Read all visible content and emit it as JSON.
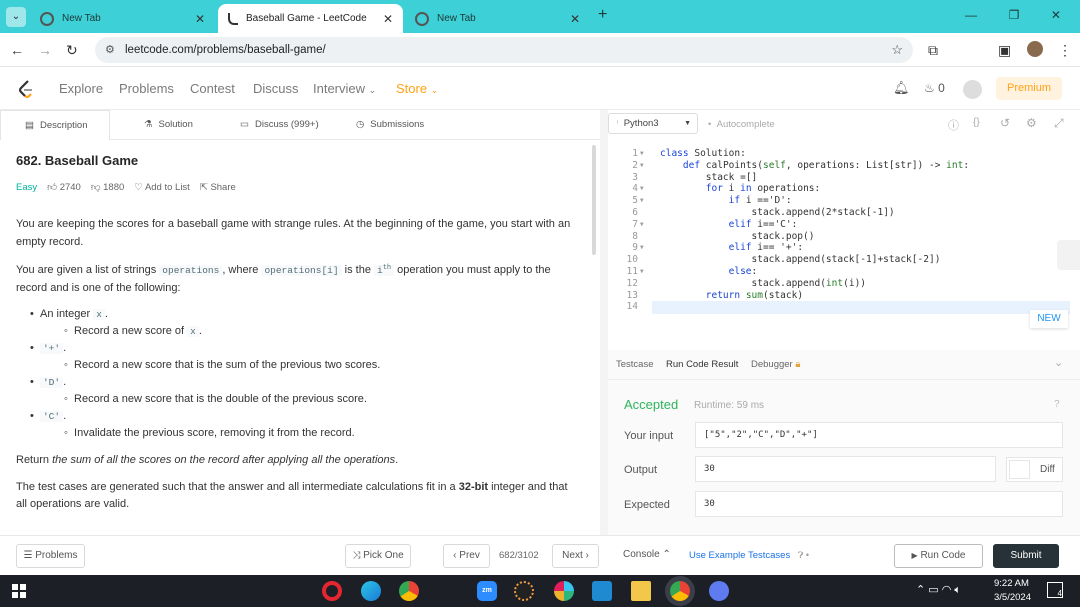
{
  "browser": {
    "tabs": [
      {
        "title": "New Tab",
        "active": false
      },
      {
        "title": "Baseball Game - LeetCode",
        "active": true
      },
      {
        "title": "New Tab",
        "active": false
      }
    ],
    "url": "leetcode.com/problems/baseball-game/"
  },
  "lc_nav": {
    "items": [
      "Explore",
      "Problems",
      "Contest",
      "Discuss",
      "Interview",
      "Store"
    ],
    "notif_count": "0",
    "premium": "Premium"
  },
  "left_tabs": [
    "Description",
    "Solution",
    "Discuss (999+)",
    "Submissions"
  ],
  "problem": {
    "title": "682. Baseball Game",
    "difficulty": "Easy",
    "likes": "2740",
    "dislikes": "1880",
    "add_to_list": "Add to List",
    "share": "Share",
    "p1": "You are keeping the scores for a baseball game with strange rules. At the beginning of the game, you start with an empty record.",
    "p2_a": "You are given a list of strings",
    "p2_code1": "operations",
    "p2_b": ", where",
    "p2_code2": "operations[i]",
    "p2_c": "is the",
    "p2_i": "i",
    "p2_sup": "th",
    "p2_d": "operation you must apply to the record and is one of the following:",
    "rules": [
      {
        "head_pre": "An integer",
        "head_code": "x",
        "head_post": ".",
        "sub": "Record a new score of",
        "sub_code": "x",
        "sub_post": "."
      },
      {
        "head_pre": "",
        "head_code": "'+'",
        "head_post": ".",
        "sub": "Record a new score that is the sum of the previous two scores.",
        "sub_code": "",
        "sub_post": ""
      },
      {
        "head_pre": "",
        "head_code": "'D'",
        "head_post": ".",
        "sub": "Record a new score that is the double of the previous score.",
        "sub_code": "",
        "sub_post": ""
      },
      {
        "head_pre": "",
        "head_code": "'C'",
        "head_post": ".",
        "sub": "Invalidate the previous score, removing it from the record.",
        "sub_code": "",
        "sub_post": ""
      }
    ],
    "p3_a": "Return",
    "p3_b": "the sum of all the scores on the record after applying all the operations",
    "p3_c": ".",
    "p4_a": "The test cases are generated such that the answer and all intermediate calculations fit in a",
    "p4_b": "32-bit",
    "p4_c": "integer and that all operations are valid."
  },
  "editor": {
    "language": "Python3",
    "autocomplete": "Autocomplete",
    "new_badge": "NEW",
    "lines": [
      "class Solution:",
      "    def calPoints(self, operations: List[str]) -> int:",
      "        stack =[]",
      "        for i in operations:",
      "            if i =='D':",
      "                stack.append(2*stack[-1])",
      "            elif i=='C':",
      "                stack.pop()",
      "            elif i== '+':",
      "                stack.append(stack[-1]+stack[-2])",
      "            else:",
      "                stack.append(int(i))",
      "        return sum(stack)",
      ""
    ],
    "folds": [
      1,
      2,
      4,
      5,
      7,
      9,
      11
    ]
  },
  "result": {
    "tabs": [
      "Testcase",
      "Run Code Result",
      "Debugger"
    ],
    "status": "Accepted",
    "runtime": "Runtime: 59 ms",
    "your_input_label": "Your input",
    "your_input": "[\"5\",\"2\",\"C\",\"D\",\"+\"]",
    "output_label": "Output",
    "output": "30",
    "diff": "Diff",
    "expected_label": "Expected",
    "expected": "30"
  },
  "footer": {
    "problems": "Problems",
    "pick_one": "Pick One",
    "prev": "Prev",
    "page": "682/3102",
    "next": "Next",
    "console": "Console",
    "use_example": "Use Example Testcases",
    "run_code": "Run Code",
    "submit": "Submit"
  },
  "taskbar": {
    "time": "9:22 AM",
    "date": "3/5/2024",
    "notif": "4"
  },
  "colors": {
    "accent": "#ffa116",
    "chrome": "#3dd0d6",
    "accepted": "#2db55d",
    "submit": "#263238"
  }
}
